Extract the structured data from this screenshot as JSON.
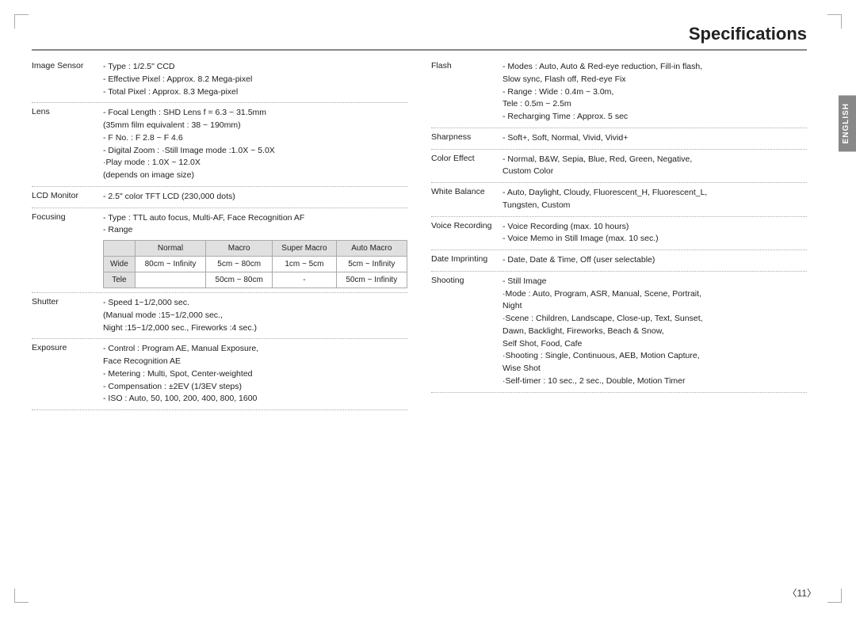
{
  "page": {
    "title": "Specifications",
    "page_number": "〈11〉",
    "english_tab": "ENGLISH"
  },
  "left_specs": [
    {
      "label": "Image Sensor",
      "value": "- Type : 1/2.5\" CCD\n- Effective Pixel : Approx. 8.2 Mega-pixel\n- Total Pixel : Approx. 8.3 Mega-pixel"
    },
    {
      "label": "Lens",
      "value": "- Focal Length : SHD Lens f = 6.3 ~ 31.5mm\n(35mm film equivalent : 38 ~ 190mm)\n- F No. : F 2.8 ~ F 4.6\n- Digital Zoom : ·Still Image mode :1.0X ~ 5.0X\n·Play mode : 1.0X ~ 12.0X\n(depends on image size)"
    },
    {
      "label": "LCD Monitor",
      "value": "- 2.5\" color TFT LCD (230,000 dots)"
    },
    {
      "label": "Focusing",
      "value": "- Type : TTL auto focus, Multi-AF, Face Recognition AF\n- Range"
    },
    {
      "label": "Shutter",
      "value": "- Speed 1~1/2,000 sec.\n(Manual mode :15~1/2,000 sec.,\nNight :15~1/2,000 sec., Fireworks :4 sec.)"
    },
    {
      "label": "Exposure",
      "value": "- Control : Program AE, Manual Exposure,\nFace Recognition AE\n- Metering : Multi, Spot, Center-weighted\n- Compensation : ±2EV (1/3EV steps)\n- ISO :  Auto, 50, 100, 200, 400, 800, 1600"
    }
  ],
  "focus_table": {
    "headers": [
      "",
      "Normal",
      "Macro",
      "Super Macro",
      "Auto Macro"
    ],
    "rows": [
      [
        "Wide",
        "80cm ~ Infinity",
        "5cm ~ 80cm",
        "1cm ~ 5cm",
        "5cm ~ Infinity"
      ],
      [
        "Tele",
        "",
        "50cm ~ 80cm",
        "-",
        "50cm ~ Infinity"
      ]
    ]
  },
  "right_specs": [
    {
      "label": "Flash",
      "value": "- Modes : Auto, Auto & Red-eye reduction, Fill-in flash,\nSlow sync, Flash off, Red-eye Fix\n- Range : Wide : 0.4m ~ 3.0m,\nTele : 0.5m ~ 2.5m\n- Recharging Time : Approx. 5 sec"
    },
    {
      "label": "Sharpness",
      "value": "- Soft+, Soft, Normal, Vivid, Vivid+"
    },
    {
      "label": "Color Effect",
      "value": "- Normal, B&W, Sepia, Blue, Red, Green, Negative,\nCustom Color"
    },
    {
      "label": "White Balance",
      "value": "- Auto, Daylight, Cloudy, Fluorescent_H, Fluorescent_L,\nTungsten, Custom"
    },
    {
      "label": "Voice Recording",
      "value": "- Voice Recording (max. 10 hours)\n- Voice Memo in Still Image (max. 10 sec.)"
    },
    {
      "label": "Date Imprinting",
      "value": "- Date, Date & Time, Off (user selectable)"
    },
    {
      "label": "Shooting",
      "value": "- Still Image\n·Mode : Auto, Program, ASR, Manual, Scene, Portrait,\nNight\n·Scene : Children, Landscape, Close-up, Text, Sunset,\nDawn, Backlight, Fireworks, Beach & Snow,\nSelf Shot, Food, Cafe\n·Shooting : Single, Continuous, AEB, Motion Capture,\nWise Shot\n·Self-timer : 10 sec., 2 sec., Double, Motion Timer"
    }
  ]
}
